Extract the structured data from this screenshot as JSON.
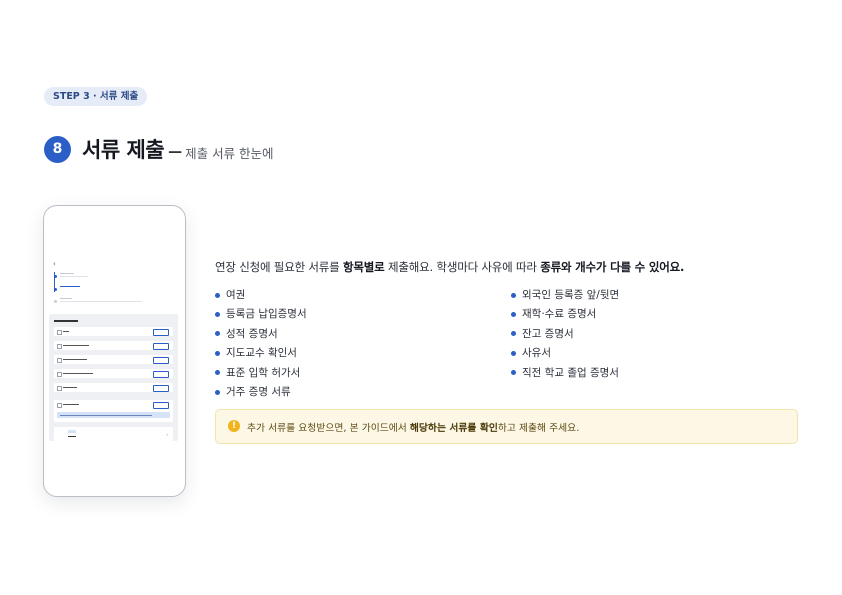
{
  "step_label": "STEP 3 · 서류 제출",
  "header": {
    "number": "8",
    "title": "서류 제출",
    "dash": "—",
    "subtitle": "제출 서류 한눈에"
  },
  "intro": {
    "part1": "연장 신청에 필요한 서류를 ",
    "bold1": "항목별로",
    "part2": " 제출해요. 학생마다 사유에 따라 ",
    "bold2": "종류와 개수가 다를 수 있어요."
  },
  "documents_left": [
    "여권",
    "등록금 납입증명서",
    "성적 증명서",
    "지도교수 확인서",
    "표준 입학 허가서",
    "거주 증명 서류"
  ],
  "documents_right": [
    "외국인 등록증 앞/뒷면",
    "재학·수료 증명서",
    "잔고 증명서",
    "사유서",
    "직전 학교 졸업 증명서"
  ],
  "notice": {
    "icon": "alert-icon",
    "part1": "추가 서류를 요청받으면, 본 가이드에서 ",
    "bold": "해당하는 서류를 확인",
    "part2": "하고 제출해 주세요."
  },
  "colors": {
    "accent": "#2b5fc7",
    "pill_bg": "#e6ecf7",
    "notice_bg": "#fdf7e5",
    "notice_icon": "#f2b41c"
  }
}
